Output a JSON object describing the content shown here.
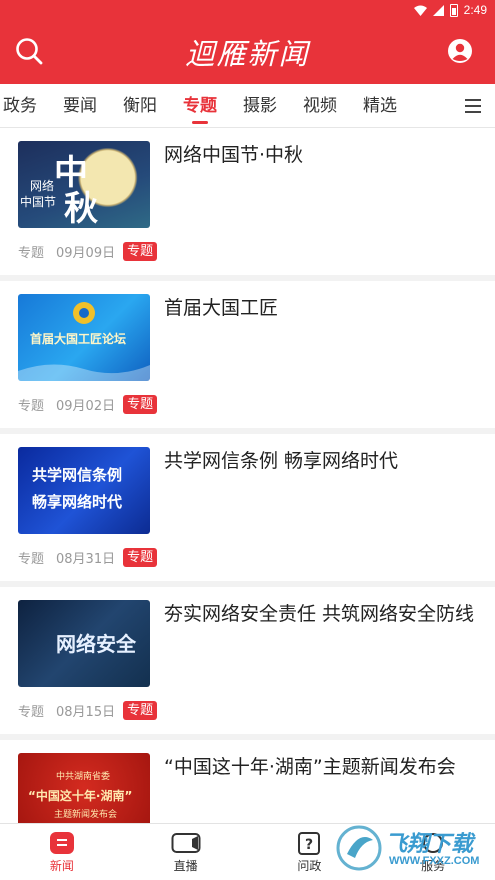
{
  "status": {
    "time": "2:49"
  },
  "header": {
    "title": "迴雁新闻",
    "search_icon": "search-icon",
    "user_icon": "user-icon"
  },
  "tabs": [
    {
      "label": "政务",
      "active": false
    },
    {
      "label": "要闻",
      "active": false
    },
    {
      "label": "衡阳",
      "active": false
    },
    {
      "label": "专题",
      "active": true
    },
    {
      "label": "摄影",
      "active": false
    },
    {
      "label": "视频",
      "active": false
    },
    {
      "label": "精选",
      "active": false
    }
  ],
  "news": [
    {
      "title": "网络中国节·中秋",
      "category": "专题",
      "date": "09月09日",
      "badge": "专题",
      "thumb_text": [
        "中",
        "秋",
        "网络",
        "中国节"
      ]
    },
    {
      "title": "首届大国工匠",
      "category": "专题",
      "date": "09月02日",
      "badge": "专题",
      "thumb_text": [
        "首届大国工匠论坛"
      ]
    },
    {
      "title": "共学网信条例 畅享网络时代",
      "category": "专题",
      "date": "08月31日",
      "badge": "专题",
      "thumb_text": [
        "共学网信条例",
        "畅享网络时代"
      ]
    },
    {
      "title": "夯实网络安全责任 共筑网络安全防线",
      "category": "专题",
      "date": "08月15日",
      "badge": "专题",
      "thumb_text": [
        "网络安全"
      ]
    },
    {
      "title": "“中国这十年·湖南”主题新闻发布会",
      "category": "",
      "date": "",
      "badge": "",
      "thumb_text": [
        "中共湖南省委",
        "“中国这十年·湖南”",
        "主题新闻发布会"
      ]
    }
  ],
  "bottom_nav": [
    {
      "label": "新闻",
      "icon": "news-icon",
      "active": true
    },
    {
      "label": "直播",
      "icon": "live-camera-icon",
      "active": false
    },
    {
      "label": "问政",
      "icon": "question-icon",
      "active": false
    },
    {
      "label": "服务",
      "icon": "service-icon",
      "active": false
    }
  ],
  "watermark": {
    "brand": "飞翔下载",
    "url": "WWW.FXXZ.COM"
  },
  "colors": {
    "brand_red": "#e8333a",
    "text": "#222222",
    "meta": "#999999"
  }
}
